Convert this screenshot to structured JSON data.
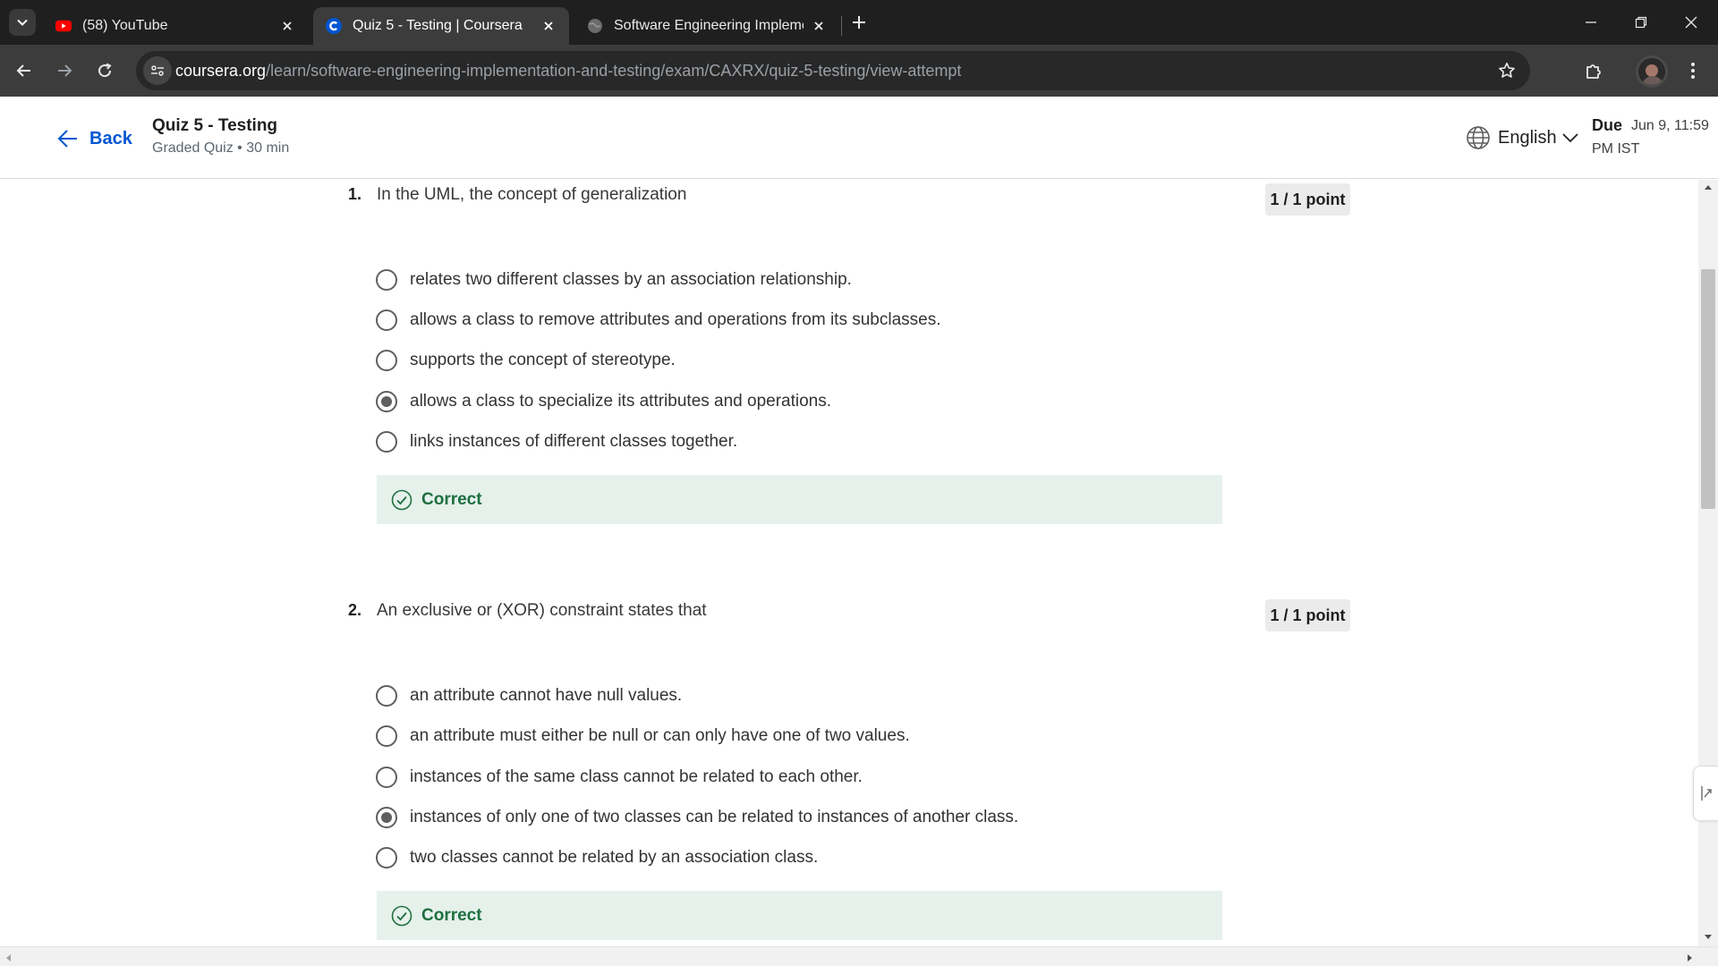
{
  "browser": {
    "tabs": [
      {
        "title": "(58) YouTube",
        "favicon": "youtube-icon",
        "active": false
      },
      {
        "title": "Quiz 5 - Testing | Coursera",
        "favicon": "coursera-icon",
        "active": true
      },
      {
        "title": "Software Engineering Implemen",
        "favicon": "globe-icon",
        "active": false
      }
    ],
    "url_host": "coursera.org",
    "url_path": "/learn/software-engineering-implementation-and-testing/exam/CAXRX/quiz-5-testing/view-attempt"
  },
  "header": {
    "back_label": "Back",
    "quiz_title": "Quiz 5 - Testing",
    "quiz_subtitle": "Graded Quiz • 30 min",
    "language": "English",
    "due_label": "Due",
    "due_date": "Jun 9, 11:59",
    "due_tz": "PM IST"
  },
  "questions": [
    {
      "number": "1.",
      "text": "In the UML, the concept of generalization",
      "points": "1 / 1 point",
      "options": [
        {
          "label": "relates two different classes by an association relationship.",
          "selected": false
        },
        {
          "label": "allows a class to remove attributes and operations from its subclasses.",
          "selected": false
        },
        {
          "label": "supports the concept of stereotype.",
          "selected": false
        },
        {
          "label": "allows a class to specialize its attributes and operations.",
          "selected": true
        },
        {
          "label": "links instances of different classes together.",
          "selected": false
        }
      ],
      "feedback": "Correct"
    },
    {
      "number": "2.",
      "text": "An exclusive or (XOR) constraint states that",
      "points": "1 / 1 point",
      "options": [
        {
          "label": "an attribute cannot have null values.",
          "selected": false
        },
        {
          "label": "an attribute must either be null or can only have one of two values.",
          "selected": false
        },
        {
          "label": "instances of the same class cannot be related to each other.",
          "selected": false
        },
        {
          "label": "instances of only one of two classes can be related to instances of another class.",
          "selected": true
        },
        {
          "label": "two classes cannot be related by an association class.",
          "selected": false
        }
      ],
      "feedback": "Correct"
    }
  ],
  "colors": {
    "link_blue": "#0056d2",
    "correct_green": "#1e6f3f",
    "correct_bg": "#e6f1ec"
  }
}
